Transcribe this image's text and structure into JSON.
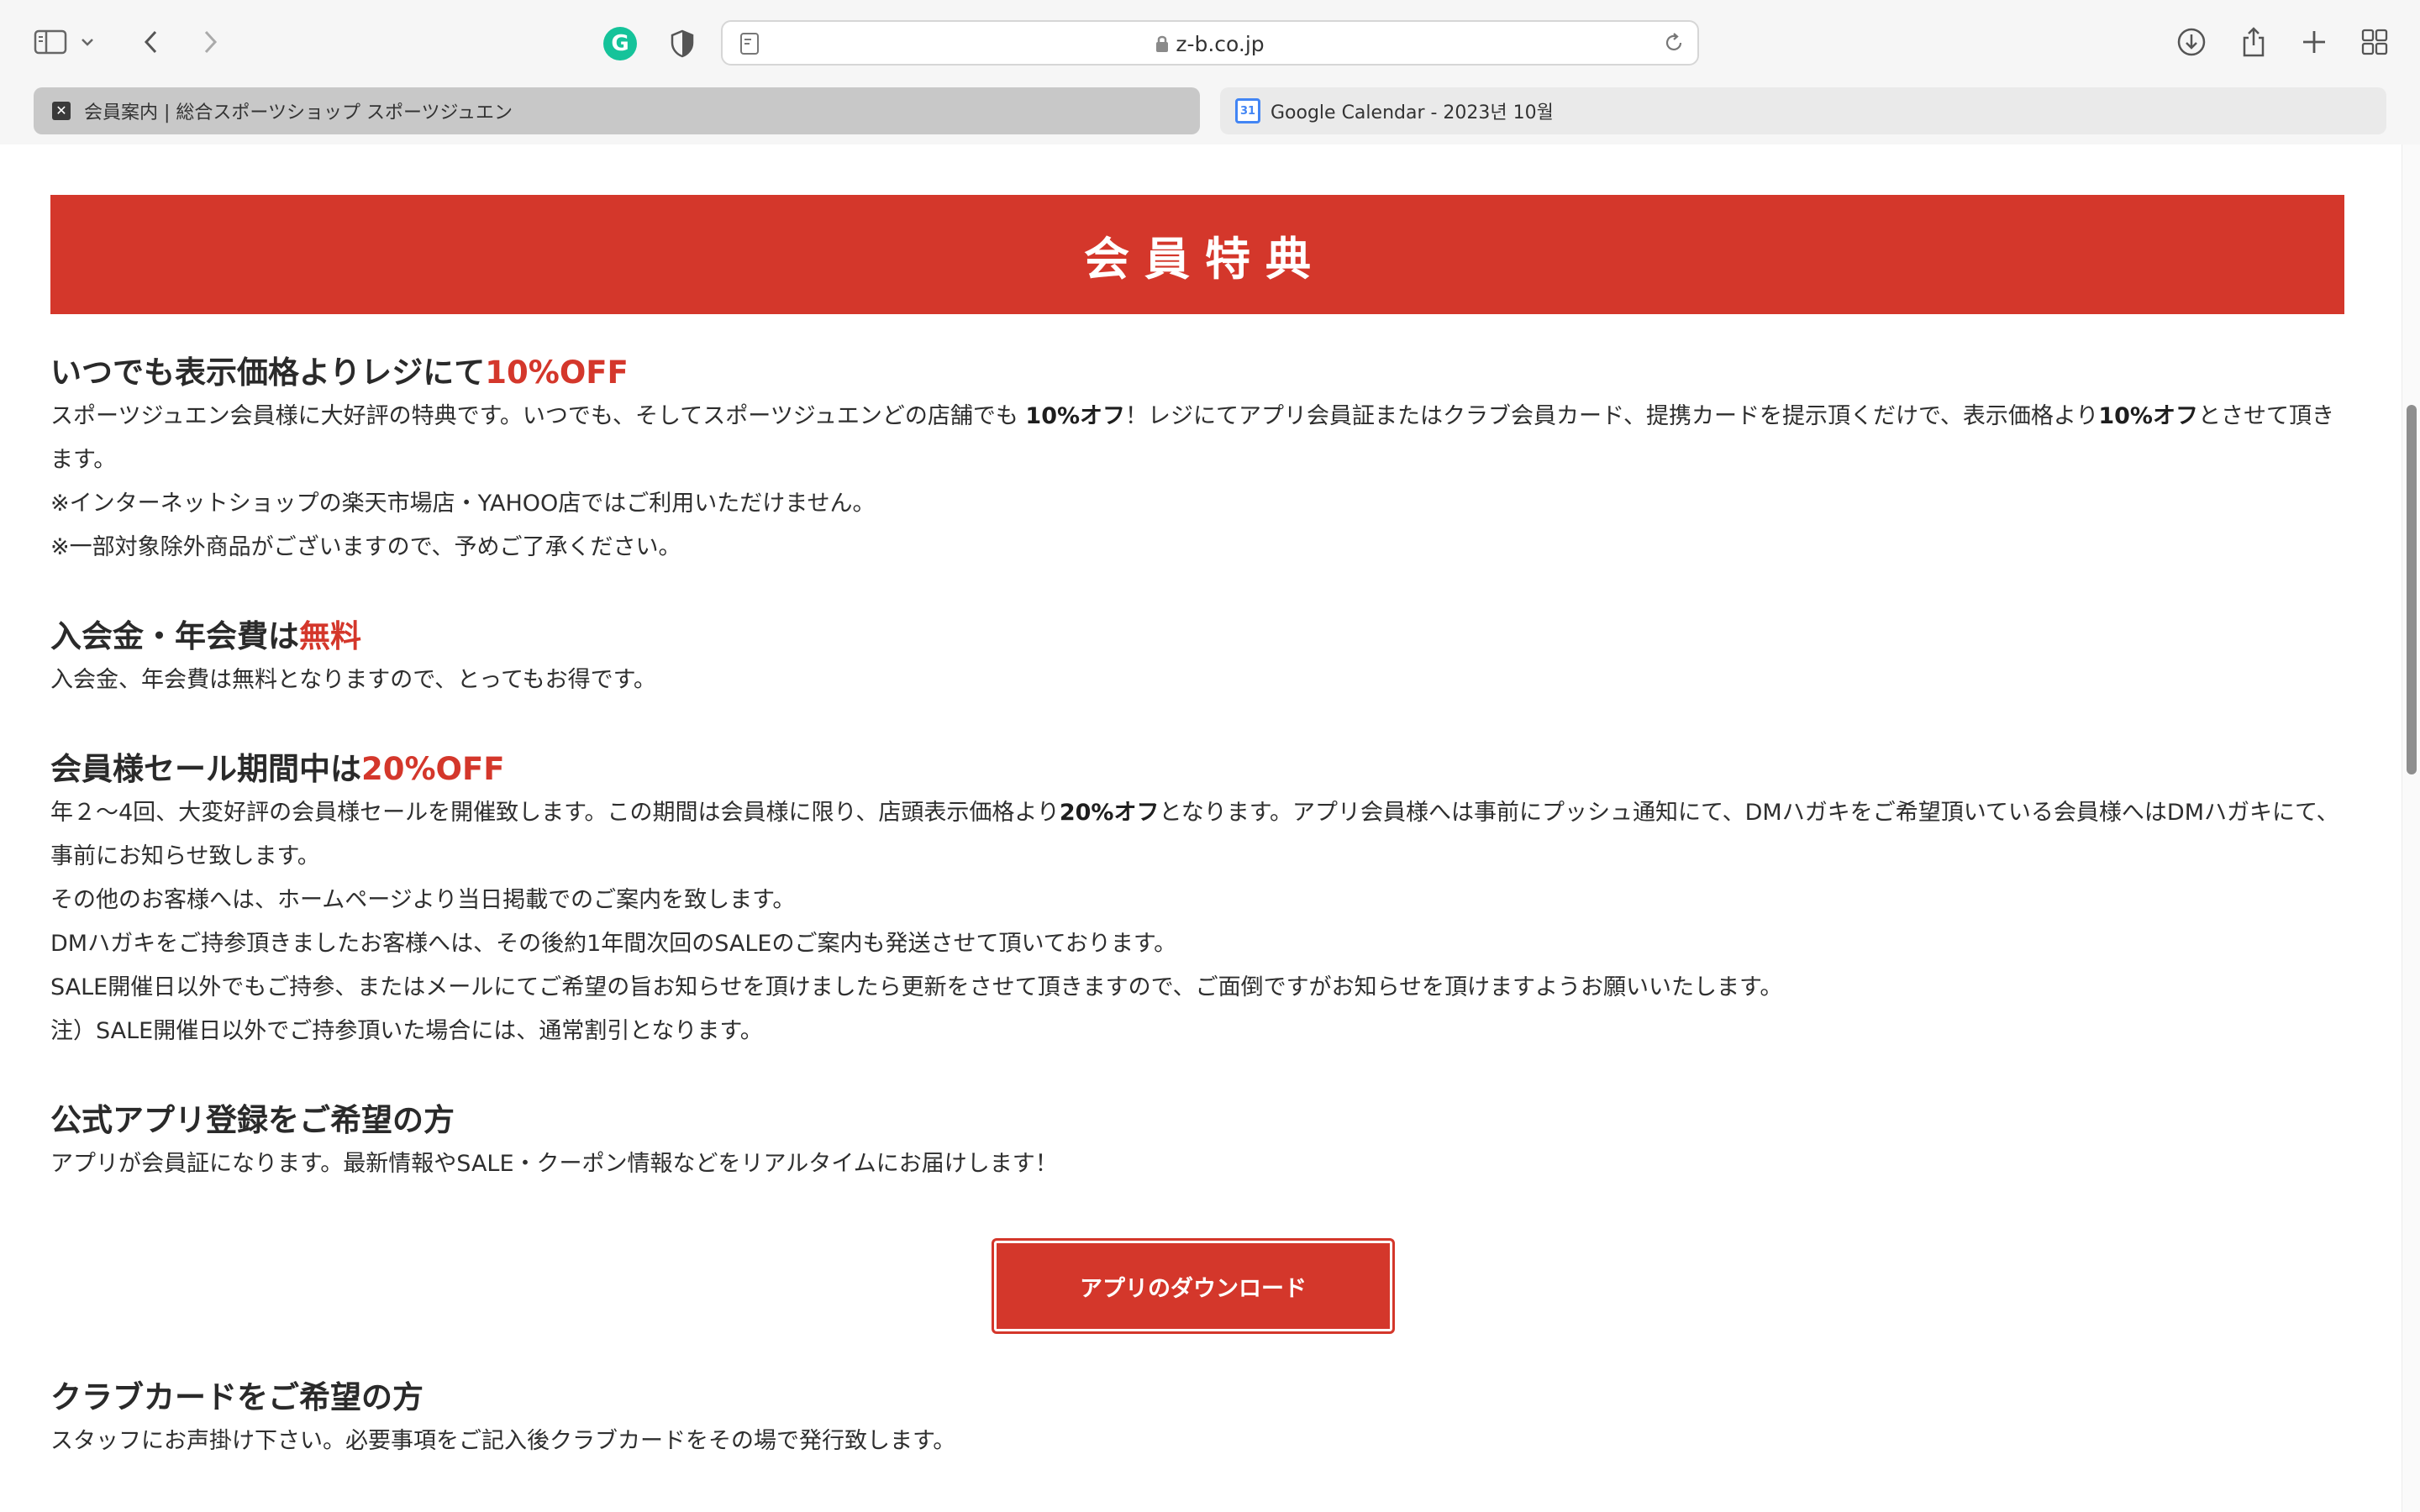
{
  "browser": {
    "url": "z-b.co.jp",
    "tabs": [
      {
        "title": "会員案内 | 総合スポーツショップ スポーツジュエン",
        "active": true
      },
      {
        "title": "Google Calendar - 2023년 10월",
        "active": false,
        "favicon_text": "31"
      }
    ],
    "extension_badge": "G"
  },
  "page": {
    "banner_title": "会員特典",
    "sections": [
      {
        "heading": "いつでも表示価格よりレジにて",
        "heading_accent": "10%OFF",
        "lines": [
          {
            "parts": [
              "スポーツジュエン会員様に大好評の特典です。いつでも、そしてスポーツジュエンどの店舗でも ",
              "10%オフ",
              "！レジにてアプリ会員証またはクラブ会員カード、提携カードを提示頂くだけで、表示価格より",
              "10%オフ",
              "とさせて頂きます。"
            ]
          },
          "※インターネットショップの楽天市場店・YAHOO店ではご利用いただけません。",
          "※一部対象除外商品がございますので、予めご了承ください。"
        ]
      },
      {
        "heading": "入会金・年会費は",
        "heading_accent": "無料",
        "lines": [
          "入会金、年会費は無料となりますので、とってもお得です。"
        ]
      },
      {
        "heading": "会員様セール期間中は",
        "heading_accent": "20%OFF",
        "lines": [
          {
            "parts": [
              "年２〜4回、大変好評の会員様セールを開催致します。この期間は会員様に限り、店頭表示価格より",
              "20%オフ",
              "となります。アプリ会員様へは事前にプッシュ通知にて、DMハガキをご希望頂いている会員様へはDMハガキにて、事前にお知らせ致します。"
            ]
          },
          "その他のお客様へは、ホームページより当日掲載でのご案内を致します。",
          "DMハガキをご持参頂きましたお客様へは、その後約1年間次回のSALEのご案内も発送させて頂いております。",
          "SALE開催日以外でもご持参、またはメールにてご希望の旨お知らせを頂けましたら更新をさせて頂きますので、ご面倒ですがお知らせを頂けますようお願いいたします。",
          "注）SALE開催日以外でご持参頂いた場合には、通常割引となります。"
        ]
      },
      {
        "heading": "公式アプリ登録をご希望の方",
        "lines": [
          "アプリが会員証になります。最新情報やSALE・クーポン情報などをリアルタイムにお届けします！"
        ]
      },
      {
        "heading": "クラブカードをご希望の方",
        "lines": [
          "スタッフにお声掛け下さい。必要事項をご記入後クラブカードをその場で発行致します。"
        ]
      }
    ],
    "download_button": "アプリのダウンロード",
    "accent_color": "#d4372b"
  }
}
